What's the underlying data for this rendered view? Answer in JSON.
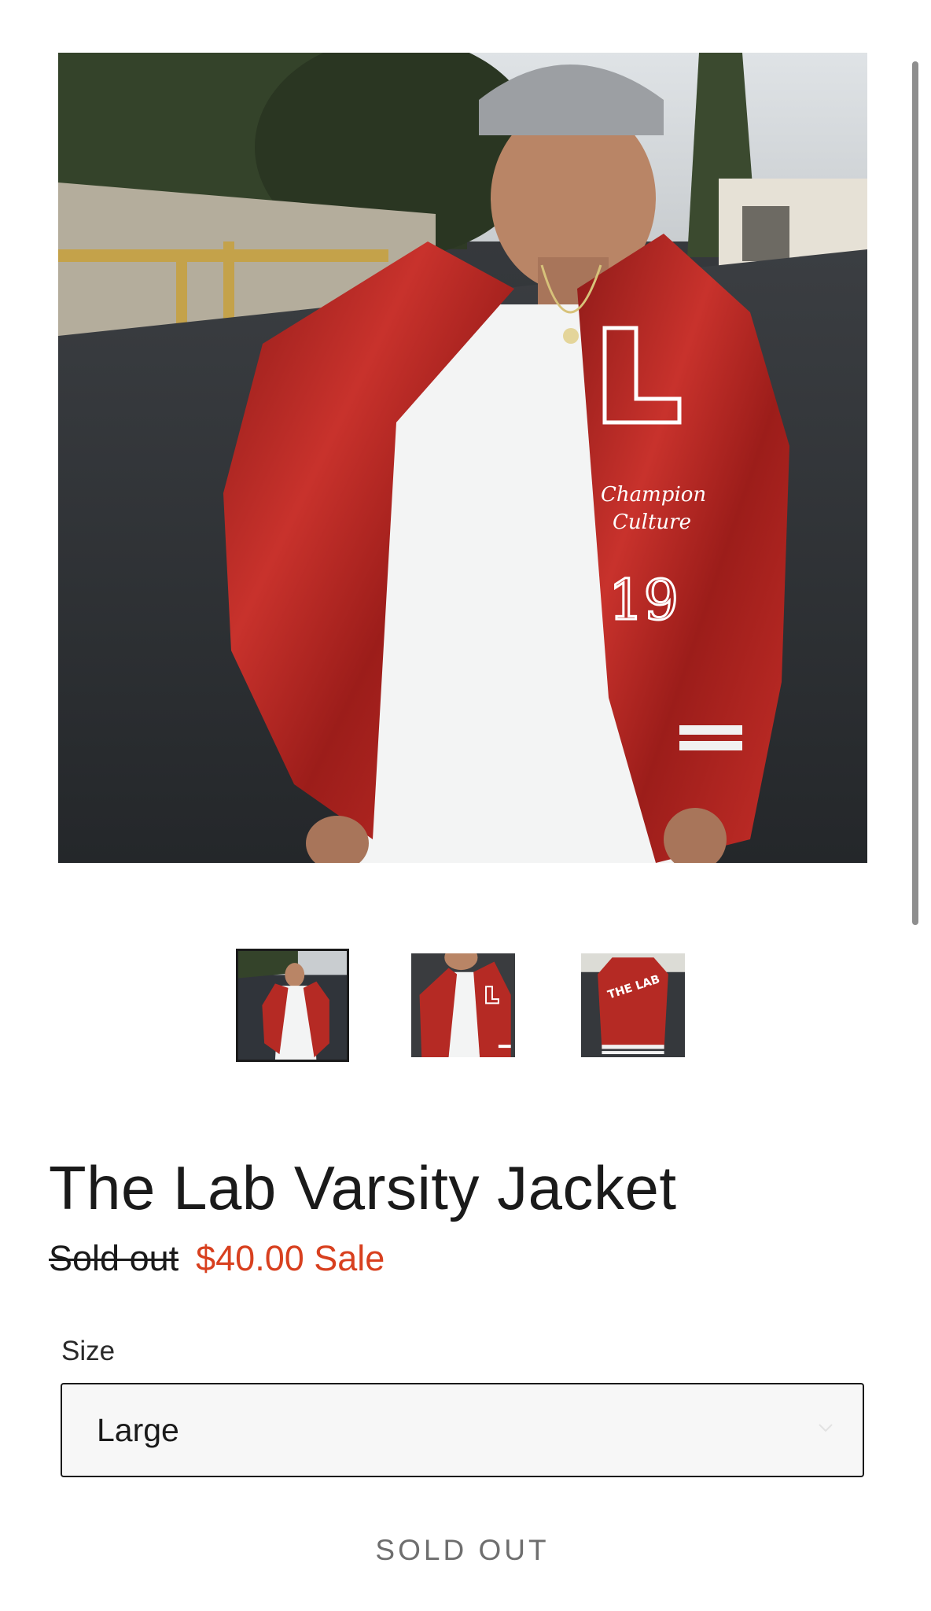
{
  "gallery": {
    "main_image_alt": "The Lab Varsity Jacket",
    "thumbnails": [
      {
        "alt": "The Lab Varsity Jacket - front view",
        "active": true
      },
      {
        "alt": "The Lab Varsity Jacket - chest detail",
        "active": false
      },
      {
        "alt": "The Lab Varsity Jacket - back view",
        "active": false
      }
    ]
  },
  "product": {
    "title": "The Lab Varsity Jacket",
    "regular_price": "Sold out",
    "sale_price": "$40.00 Sale"
  },
  "size_selector": {
    "label": "Size",
    "selected": "Large"
  },
  "buy_button": {
    "label": "SOLD OUT"
  },
  "colors": {
    "sale": "#d8401f",
    "jacket_red": "#b0231f",
    "text": "#1a1a1a"
  }
}
